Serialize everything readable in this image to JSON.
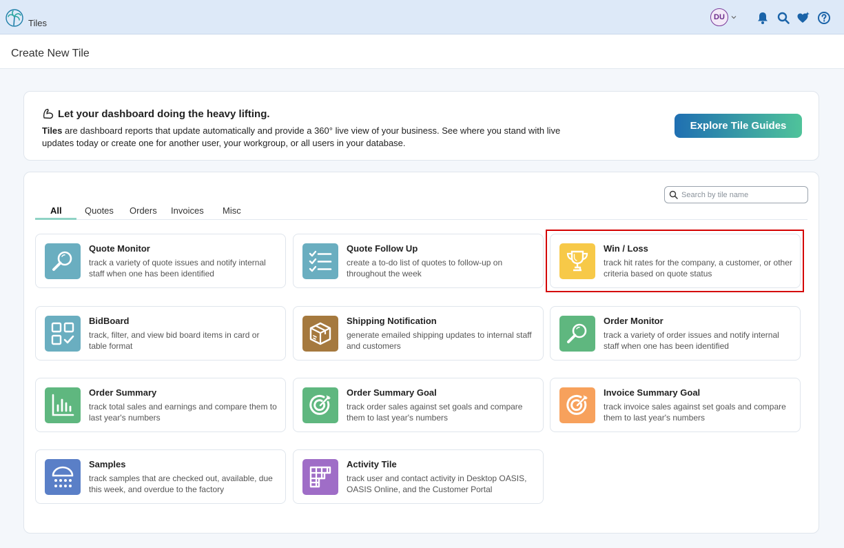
{
  "app": {
    "name": "Tiles",
    "user_initials": "DU"
  },
  "page": {
    "title": "Create New Tile"
  },
  "hero": {
    "title": "Let your dashboard doing the heavy lifting.",
    "desc_bold": "Tiles",
    "desc_rest": " are dashboard reports that update automatically and provide a 360° live view of your business. See where you stand with live updates today or create one for another user, your workgroup, or all users in your database.",
    "button_label": "Explore Tile Guides"
  },
  "search": {
    "placeholder": "Search by tile name",
    "value": ""
  },
  "tabs": [
    "All",
    "Quotes",
    "Orders",
    "Invoices",
    "Misc"
  ],
  "active_tab": "All",
  "tiles": [
    {
      "title": "Quote Monitor",
      "desc": "track a variety of quote issues and notify internal staff when one has been identified",
      "icon": "magnifier-icon",
      "color": "#6aaec0"
    },
    {
      "title": "Quote Follow Up",
      "desc": "create a to-do list of quotes to follow-up on throughout the week",
      "icon": "checklist-icon",
      "color": "#6aaec0"
    },
    {
      "title": "Win / Loss",
      "desc": "track hit rates for the company, a customer, or other criteria based on quote status",
      "icon": "trophy-icon",
      "color": "#f7c948"
    },
    {
      "title": "BidBoard",
      "desc": "track, filter, and view bid board items in card or table format",
      "icon": "grid-check-icon",
      "color": "#6aaec0"
    },
    {
      "title": "Shipping Notification",
      "desc": "generate emailed shipping updates to internal staff and customers",
      "icon": "package-icon",
      "color": "#a5793e"
    },
    {
      "title": "Order Monitor",
      "desc": "track a variety of order issues and notify internal staff when one has been identified",
      "icon": "magnifier-icon",
      "color": "#5fb77f"
    },
    {
      "title": "Order Summary",
      "desc": "track total sales and earnings and compare them to last year's numbers",
      "icon": "bar-chart-icon",
      "color": "#5fb77f"
    },
    {
      "title": "Order Summary Goal",
      "desc": "track order sales against set goals and compare them to last year's numbers",
      "icon": "target-icon",
      "color": "#5fb77f"
    },
    {
      "title": "Invoice Summary Goal",
      "desc": "track invoice sales against set goals and compare them to last year's numbers",
      "icon": "target-icon",
      "color": "#f7a15c"
    },
    {
      "title": "Samples",
      "desc": "track samples that are checked out, available, due this week, and overdue to the factory",
      "icon": "calendar-dots-icon",
      "color": "#5a7fc7"
    },
    {
      "title": "Activity Tile",
      "desc": "track user and contact activity in Desktop OASIS, OASIS Online, and the Customer Portal",
      "icon": "activity-grid-icon",
      "color": "#9f6dc7"
    }
  ]
}
